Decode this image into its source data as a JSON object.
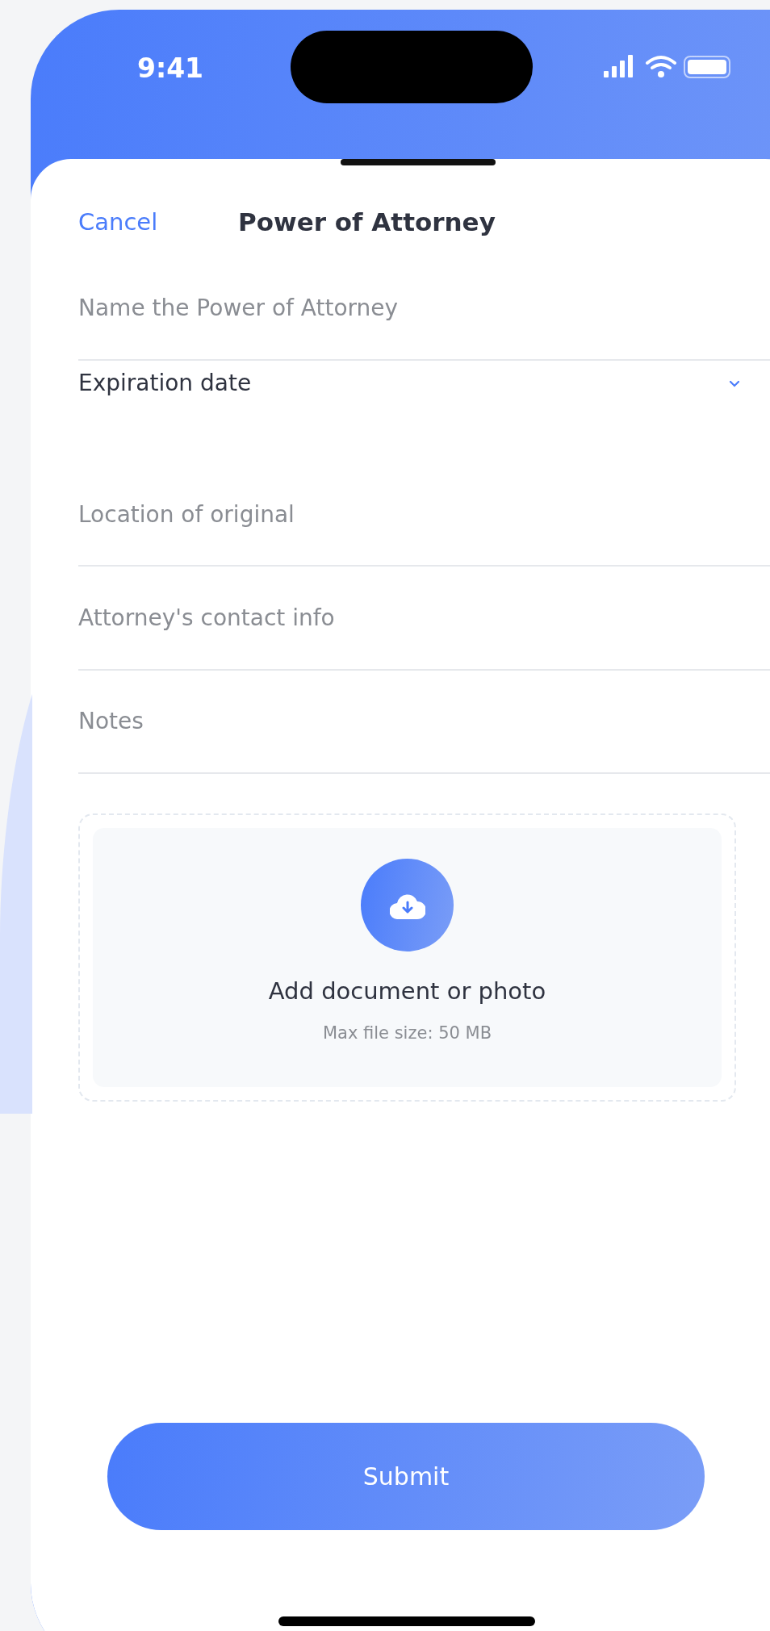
{
  "status_bar": {
    "time": "9:41"
  },
  "header": {
    "cancel": "Cancel",
    "title": "Power of Attorney"
  },
  "fields": [
    {
      "kind": "text",
      "placeholder": "Name the Power of Attorney"
    },
    {
      "kind": "select",
      "value": "Expiration date"
    },
    {
      "kind": "text",
      "placeholder": "Location of original"
    },
    {
      "kind": "text",
      "placeholder": "Attorney's contact info"
    },
    {
      "kind": "text",
      "placeholder": "Notes"
    }
  ],
  "upload": {
    "title": "Add document or photo",
    "hint": "Max file size: 50 MB"
  },
  "submit": "Submit"
}
